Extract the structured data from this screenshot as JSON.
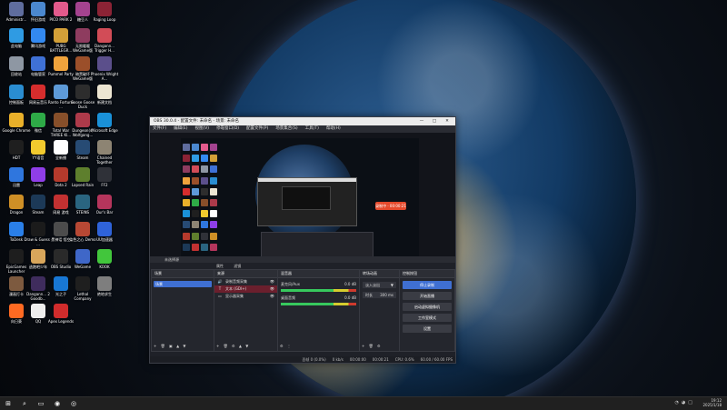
{
  "desktop": {
    "icons": [
      {
        "label": "Administr...",
        "color": "#5f6d9e"
      },
      {
        "label": "怀旧游戏",
        "color": "#4b88cf"
      },
      {
        "label": "PICO PARK 2",
        "color": "#e35a8c"
      },
      {
        "label": "糖豆人",
        "color": "#a4438f"
      },
      {
        "label": "Raging Loop",
        "color": "#8b2335"
      },
      {
        "label": "此电脑",
        "color": "#2f9be3"
      },
      {
        "label": "腾讯游戏",
        "color": "#3389f0"
      },
      {
        "label": "PUBG BATTLEGR...",
        "color": "#d3a038"
      },
      {
        "label": "无限暖暖 WeGame版",
        "color": "#8e3c5f"
      },
      {
        "label": "Dangann... Trigger H...",
        "color": "#d24c57"
      },
      {
        "label": "回收站",
        "color": "#8e97a3"
      },
      {
        "label": "电脑管家",
        "color": "#3f71d6"
      },
      {
        "label": "Pummel Party",
        "color": "#f0a33c"
      },
      {
        "label": "暗黑破坏 WeGame版",
        "color": "#9b4f2a"
      },
      {
        "label": "Phoenix Wright A...",
        "color": "#5b4f8b"
      },
      {
        "label": "控制面板",
        "color": "#2a8dd1"
      },
      {
        "label": "网易云音乐",
        "color": "#d62d2d"
      },
      {
        "label": "Ranto Fortune ...",
        "color": "#5d9ad8"
      },
      {
        "label": "Goose Goose Duck",
        "color": "#2d2d2d"
      },
      {
        "label": "新建文档",
        "color": "#ece5d2"
      },
      {
        "label": "Google Chrome",
        "color": "#e9b02a"
      },
      {
        "label": "微信",
        "color": "#2eaa47"
      },
      {
        "label": "Total War THREE KI...",
        "color": "#874f2a"
      },
      {
        "label": "Dungeon(s) Wolfgang...",
        "color": "#ad3a4a"
      },
      {
        "label": "Microsoft Edge",
        "color": "#1a91d8"
      },
      {
        "label": "HDT",
        "color": "#1f1f1f"
      },
      {
        "label": "YY语音",
        "color": "#f2ca2e"
      },
      {
        "label": "全新播",
        "color": "#ffffff"
      },
      {
        "label": "Steam",
        "color": "#274b74"
      },
      {
        "label": "Chained Together",
        "color": "#8d8473"
      },
      {
        "label": "迅雷",
        "color": "#2f76de"
      },
      {
        "label": "Leap",
        "color": "#8f3ee8"
      },
      {
        "label": "Dota 2",
        "color": "#b53a2c"
      },
      {
        "label": "Lapsed Rain",
        "color": "#5e7f2d"
      },
      {
        "label": "FF2",
        "color": "#2f3138"
      },
      {
        "label": "Dragon",
        "color": "#ce8f26"
      },
      {
        "label": "Steam",
        "color": "#1c3957"
      },
      {
        "label": "网易 游戏",
        "color": "#c23131"
      },
      {
        "label": "STEINS",
        "color": "#2a6580"
      },
      {
        "label": "Our's Bar",
        "color": "#b5355c"
      },
      {
        "label": "ToDesk",
        "color": "#2a7fe8"
      },
      {
        "label": "Draw & Guess - ...",
        "color": "#1b1b1b"
      },
      {
        "label": "黑神话 悟空",
        "color": "#4c4c4c"
      },
      {
        "label": "染色之心 Demo",
        "color": "#b74834"
      },
      {
        "label": "UU加速器",
        "color": "#2f63d9"
      },
      {
        "label": "EpicGames Launcher",
        "color": "#1e1e1e"
      },
      {
        "label": "逃跑吧少年",
        "color": "#d8a65b"
      },
      {
        "label": "OBS Studio",
        "color": "#2a2a2a"
      },
      {
        "label": "WeGame",
        "color": "#3f67c8"
      },
      {
        "label": "KOOK",
        "color": "#42c63c"
      },
      {
        "label": "漫画打卡",
        "color": "#7d5a3f"
      },
      {
        "label": "Dangann... 2 Goodb...",
        "color": "#3f2c5d"
      },
      {
        "label": "光之子",
        "color": "#1877d4"
      },
      {
        "label": "Lethal Company",
        "color": "#1f1f1f"
      },
      {
        "label": "绝地求生",
        "color": "#7e7e7e"
      },
      {
        "label": "向日葵",
        "color": "#ff6a22"
      },
      {
        "label": "QQ",
        "color": "#eeeeee"
      },
      {
        "label": "Apex Legends",
        "color": "#d12c2c"
      }
    ]
  },
  "obs": {
    "title": "OBS 30.0.4 - 配置文件: 未命名 - 场景: 未命名",
    "window_controls": [
      "—",
      "□",
      "✕"
    ],
    "menu": [
      "文件(F)",
      "编辑(E)",
      "视图(V)",
      "停靠窗口(D)",
      "配置文件(P)",
      "场景集合(S)",
      "工具(T)",
      "帮助(H)"
    ],
    "preview": {
      "badge_text": "录制中 · 00:00:21"
    },
    "source_toolbar": "未选择源",
    "tabs": {
      "properties": "属性",
      "filters": "滤镜"
    },
    "scenes": {
      "title": "场景",
      "items": [
        "场景"
      ]
    },
    "sources": {
      "title": "来源",
      "items": [
        "录制音频采集",
        "文本 (GDI+)",
        "显示器采集"
      ]
    },
    "mixer": {
      "title": "混音器",
      "tracks": [
        {
          "name": "麦克风/Aux",
          "value": "0.0 dB"
        },
        {
          "name": "桌面音频",
          "value": "0.0 dB"
        }
      ]
    },
    "transitions": {
      "title": "转场动画",
      "effect": "淡入淡出",
      "duration_label": "时长",
      "duration_value": "300 ms"
    },
    "controls": {
      "title": "控制按钮",
      "buttons": [
        "停止录制",
        "开始直播",
        "启动虚拟摄像机",
        "工作室模式",
        "设置"
      ]
    },
    "status": {
      "frames": "丢帧 0 (0.0%)",
      "bitrate": "0 kb/s",
      "rec_time": "00:00:00",
      "stream_time": "00:00:21",
      "cpu": "CPU: 0.6%",
      "fps": "60.00 / 60.00 FPS"
    }
  },
  "taskbar": {
    "time": "19:12",
    "date": "2025/1/18",
    "items": [
      "⊞",
      "⌕",
      "▭",
      "◉",
      "◎"
    ]
  }
}
